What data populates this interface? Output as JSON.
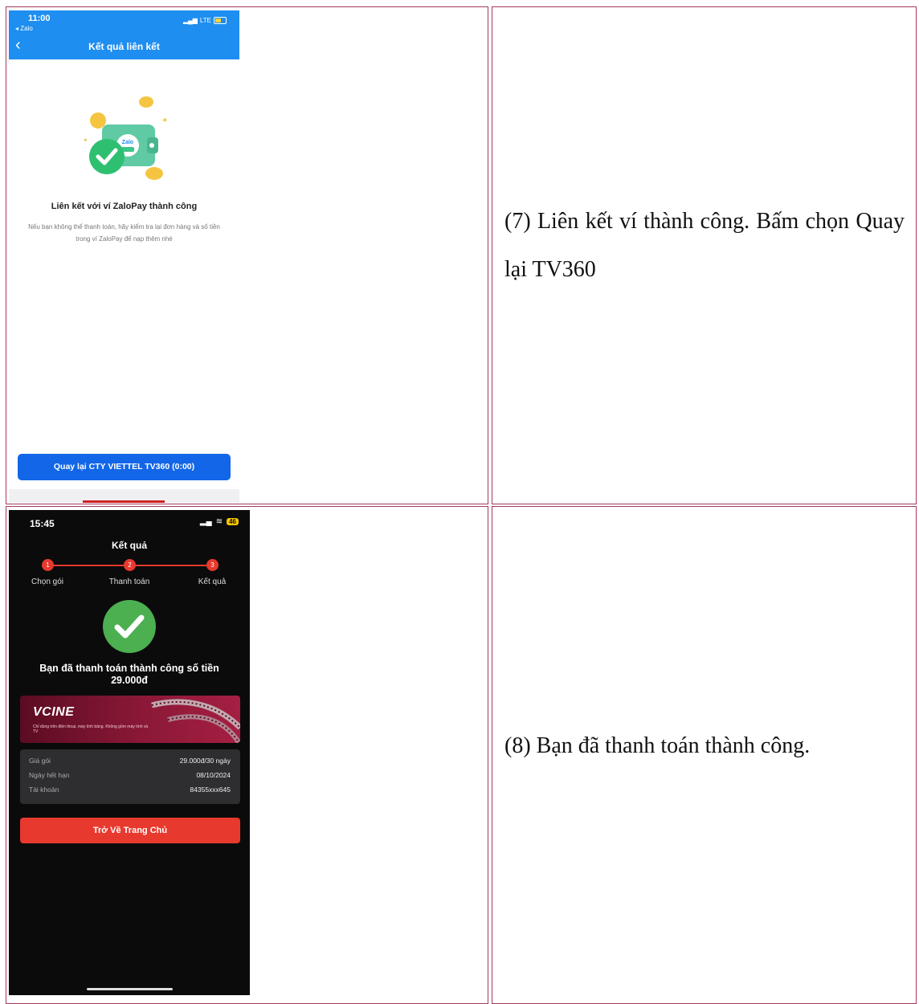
{
  "row1": {
    "description": "(7) Liên kết ví thành công. Bấm chọn Quay lại TV360",
    "screen": {
      "time": "11:00",
      "back_app": "◂ Zalo",
      "network": "LTE",
      "title": "Kết quả liên kết",
      "logo_text": "Zalo",
      "heading": "Liên kết với ví ZaloPay thành công",
      "subtext": "Nếu bạn không thể thanh toán, hãy kiểm tra lại đơn hàng và số tiền trong ví ZaloPay để nạp thêm nhé",
      "button": "Quay lại CTY VIETTEL TV360 (0:00)"
    }
  },
  "row2": {
    "description": "(8) Bạn đã thanh toán thành công.",
    "screen": {
      "time": "15:45",
      "battery": "46",
      "title": "Kết quả",
      "steps": [
        {
          "num": "1",
          "label": "Chọn gói"
        },
        {
          "num": "2",
          "label": "Thanh toán"
        },
        {
          "num": "3",
          "label": "Kết quả"
        }
      ],
      "message": "Bạn đã thanh toán thành công số tiền 29.000đ",
      "banner_logo": "VCINE",
      "banner_sub": "Chỉ dùng trên điện thoại, máy tính bảng. Không gồm máy tính và TV",
      "info": [
        {
          "label": "Giá gói",
          "value": "29.000đ/30 ngày"
        },
        {
          "label": "Ngày hết hạn",
          "value": "08/10/2024"
        },
        {
          "label": "Tài khoản",
          "value": "84355xxx645"
        }
      ],
      "button": "Trở Về Trang Chủ"
    }
  }
}
